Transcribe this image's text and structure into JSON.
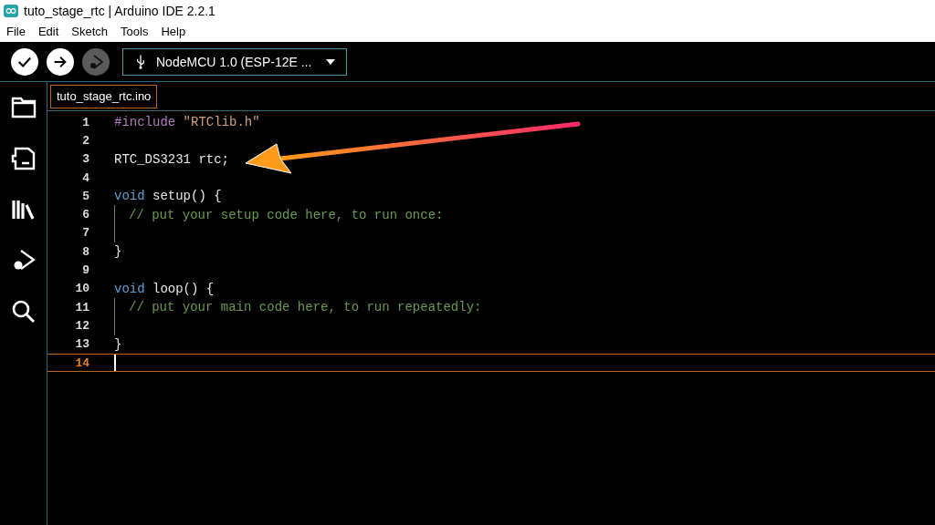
{
  "window": {
    "title": "tuto_stage_rtc | Arduino IDE 2.2.1"
  },
  "menu": [
    "File",
    "Edit",
    "Sketch",
    "Tools",
    "Help"
  ],
  "toolbar": {
    "buttons": [
      {
        "kind": "verify",
        "disabled": false
      },
      {
        "kind": "upload",
        "disabled": false
      },
      {
        "kind": "debug",
        "disabled": true
      }
    ],
    "board": "NodeMCU 1.0 (ESP-12E ..."
  },
  "sidebar": {
    "items": [
      {
        "kind": "folder"
      },
      {
        "kind": "board"
      },
      {
        "kind": "library"
      },
      {
        "kind": "debug"
      },
      {
        "kind": "search"
      }
    ]
  },
  "tabs": [
    {
      "label": "tuto_stage_rtc.ino",
      "selected": true
    }
  ],
  "editor": {
    "lines": [
      {
        "number": "1",
        "guide": false,
        "current": false,
        "tokens": [
          {
            "kind": "directive",
            "text": "#include"
          },
          {
            "kind": "string",
            "text": " \"RTClib.h\""
          }
        ]
      },
      {
        "number": "2",
        "guide": false,
        "current": false
      },
      {
        "number": "3",
        "guide": false,
        "current": false,
        "tokens": [
          {
            "kind": "plain",
            "text": "RTC_DS3231 rtc;"
          }
        ]
      },
      {
        "number": "4",
        "guide": false,
        "current": false
      },
      {
        "number": "5",
        "guide": false,
        "current": false,
        "tokens": [
          {
            "kind": "keyword",
            "text": "void"
          },
          {
            "kind": "plain",
            "text": " setup() {"
          }
        ]
      },
      {
        "number": "6",
        "guide": true,
        "current": false,
        "tokens": [
          {
            "kind": "comment",
            "text": "// put your setup code here, to run once:"
          }
        ]
      },
      {
        "number": "7",
        "guide": true,
        "current": false
      },
      {
        "number": "8",
        "guide": false,
        "current": false,
        "tokens": [
          {
            "kind": "plain",
            "text": "}"
          }
        ]
      },
      {
        "number": "9",
        "guide": false,
        "current": false
      },
      {
        "number": "10",
        "guide": false,
        "current": false,
        "tokens": [
          {
            "kind": "keyword",
            "text": "void"
          },
          {
            "kind": "plain",
            "text": " loop() {"
          }
        ]
      },
      {
        "number": "11",
        "guide": true,
        "current": false,
        "tokens": [
          {
            "kind": "comment",
            "text": "// put your main code here, to run repeatedly:"
          }
        ]
      },
      {
        "number": "12",
        "guide": true,
        "current": false
      },
      {
        "number": "13",
        "guide": false,
        "current": false,
        "tokens": [
          {
            "kind": "plain",
            "text": "}"
          }
        ]
      },
      {
        "number": "14",
        "guide": false,
        "current": true
      }
    ]
  }
}
